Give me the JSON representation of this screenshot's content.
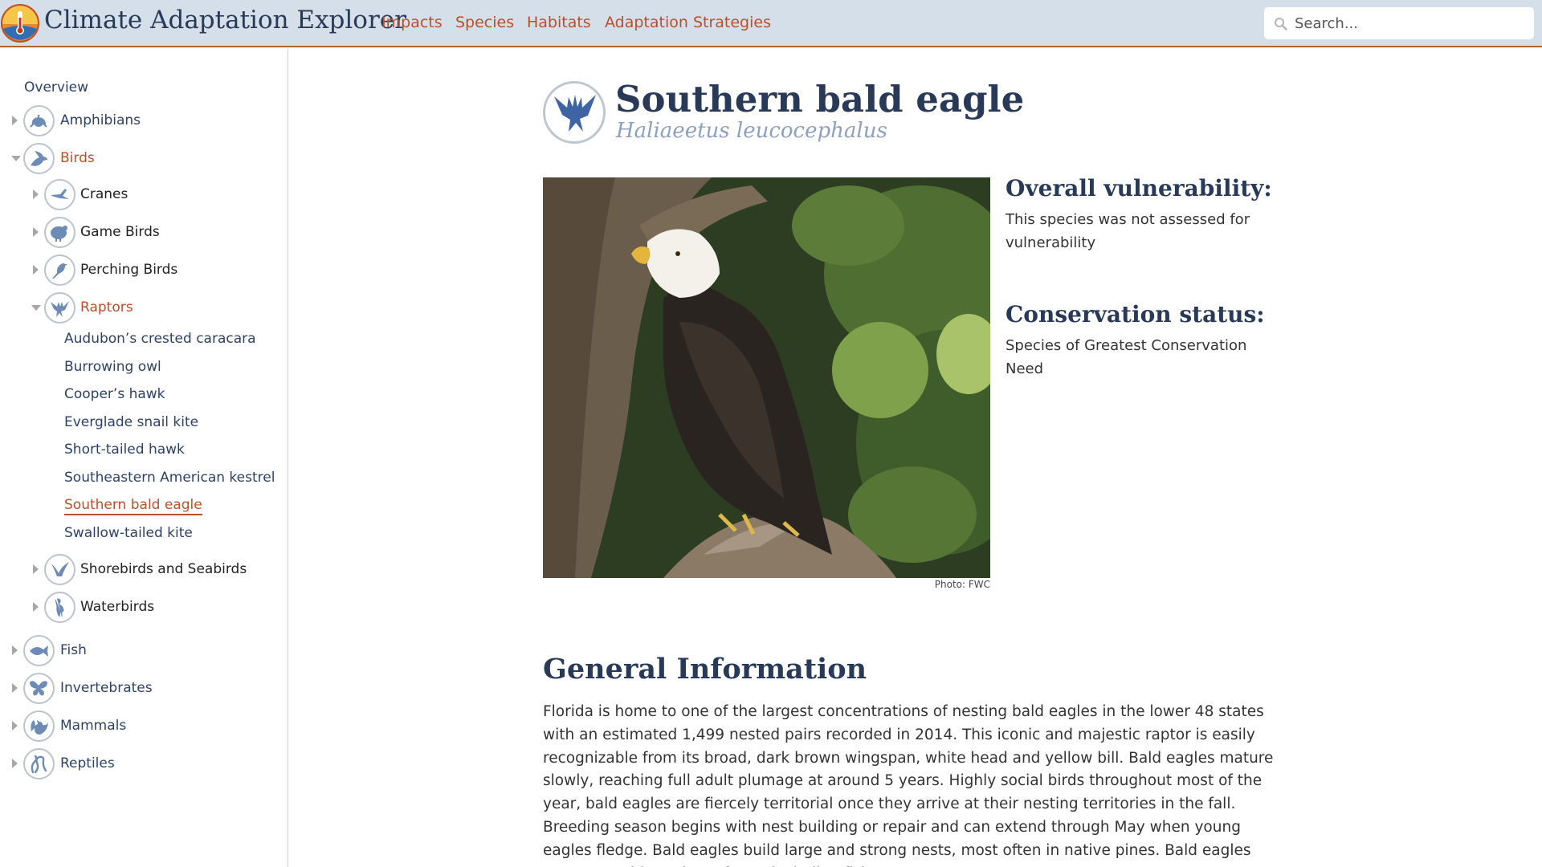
{
  "app": {
    "title": "Climate Adaptation Explorer"
  },
  "nav": {
    "links": [
      "Impacts",
      "Species",
      "Habitats",
      "Adaptation Strategies"
    ]
  },
  "search": {
    "placeholder": "Search..."
  },
  "sidebar": {
    "overview": "Overview",
    "groups": [
      {
        "label": "Amphibians",
        "icon": "frog-icon",
        "expanded": false
      },
      {
        "label": "Birds",
        "icon": "bird-icon",
        "expanded": true,
        "subgroups": [
          {
            "label": "Cranes",
            "icon": "crane-icon",
            "expanded": false
          },
          {
            "label": "Game Birds",
            "icon": "turkey-icon",
            "expanded": false
          },
          {
            "label": "Perching Birds",
            "icon": "songbird-icon",
            "expanded": false
          },
          {
            "label": "Raptors",
            "icon": "eagle-icon",
            "expanded": true,
            "species": [
              "Audubon’s crested caracara",
              "Burrowing owl",
              "Cooper’s hawk",
              "Everglade snail kite",
              "Short-tailed hawk",
              "Southeastern American kestrel",
              "Southern bald eagle",
              "Swallow-tailed kite"
            ],
            "current_species": "Southern bald eagle"
          },
          {
            "label": "Shorebirds and Seabirds",
            "icon": "seabird-icon",
            "expanded": false
          },
          {
            "label": "Waterbirds",
            "icon": "heron-icon",
            "expanded": false
          }
        ]
      },
      {
        "label": "Fish",
        "icon": "fish-icon",
        "expanded": false
      },
      {
        "label": "Invertebrates",
        "icon": "butterfly-icon",
        "expanded": false
      },
      {
        "label": "Mammals",
        "icon": "squirrel-icon",
        "expanded": false
      },
      {
        "label": "Reptiles",
        "icon": "snake-icon",
        "expanded": false
      }
    ]
  },
  "species": {
    "common_name": "Southern bald eagle",
    "scientific_name": "Haliaeetus leucocephalus",
    "photo_credit": "Photo: FWC",
    "vulnerability_heading": "Overall vulnerability:",
    "vulnerability_text": "This species was not assessed for vulnerability",
    "conservation_heading": "Conservation status:",
    "conservation_text": "Species of Greatest Conservation Need",
    "general_heading": "General Information",
    "general_text": "Florida is home to one of the largest concentrations of nesting bald eagles in the lower 48 states with an estimated 1,499 nested pairs recorded in 2014. This iconic and majestic raptor is easily recognizable from its broad, dark brown wingspan, white head and yellow bill. Bald eagles mature slowly, reaching full adult plumage at around 5 years. Highly social birds throughout most of the year, bald eagles are fiercely territorial once they arrive at their nesting territories in the fall. Breeding season begins with nest building or repair and can extend through May when young eagles fledge. Bald eagles build large and strong nests, most often in native pines. Bald eagles capture a wide variety of prey including fish,"
  },
  "colors": {
    "accent": "#b8512a",
    "navy": "#283a57",
    "link": "#2d4266",
    "topbar_bg": "#d4dfea"
  }
}
